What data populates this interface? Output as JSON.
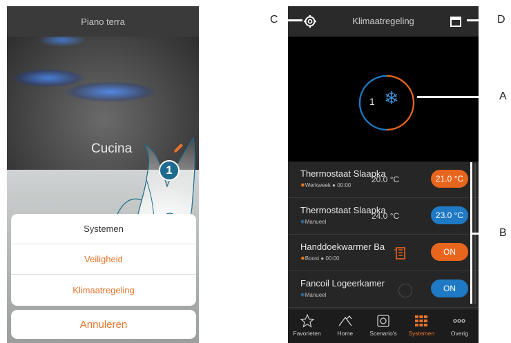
{
  "left": {
    "title": "Piano terra",
    "room": "Cucina",
    "step_number": "1",
    "menu": [
      "Systemen",
      "Veiligheid",
      "Klimaatregeling"
    ],
    "cancel_label": "Annuleren"
  },
  "right": {
    "title": "Klimaatregeling",
    "mode_number": "1",
    "devices": [
      {
        "name": "Thermostaat Slaapka",
        "sub": "Werkweek",
        "time": "00:00",
        "temp": "20.0 °C",
        "pill": "21.0 °C"
      },
      {
        "name": "Thermostaat Slaapka",
        "sub": "Manueel",
        "time": "",
        "temp": "24.0 °C",
        "pill": "23.0 °C"
      },
      {
        "name": "Handdoekwarmer Ba",
        "sub": "Boost",
        "time": "00:00",
        "temp": "",
        "pill": "ON"
      },
      {
        "name": "Fancoil Logeerkamer",
        "sub": "Manueel",
        "time": "",
        "temp": "",
        "pill": "ON"
      }
    ],
    "nav": [
      "Favorieten",
      "Home",
      "Scenario's",
      "Systemen",
      "Overig"
    ],
    "active_nav": "Systemen"
  },
  "callouts": {
    "a": "A",
    "b": "B",
    "c": "C",
    "d": "D"
  },
  "colors": {
    "accent_orange": "#e8742a",
    "accent_blue": "#1f79c4",
    "step_badge": "#1d6b8e"
  },
  "icons": [
    "edit-icon",
    "gear-icon",
    "calendar-icon",
    "snowflake-icon",
    "sun-icon",
    "clock-icon",
    "towel-warmer-icon",
    "fan-icon",
    "star-icon",
    "home-icon",
    "scenario-icon",
    "grid-icon",
    "more-icon"
  ]
}
